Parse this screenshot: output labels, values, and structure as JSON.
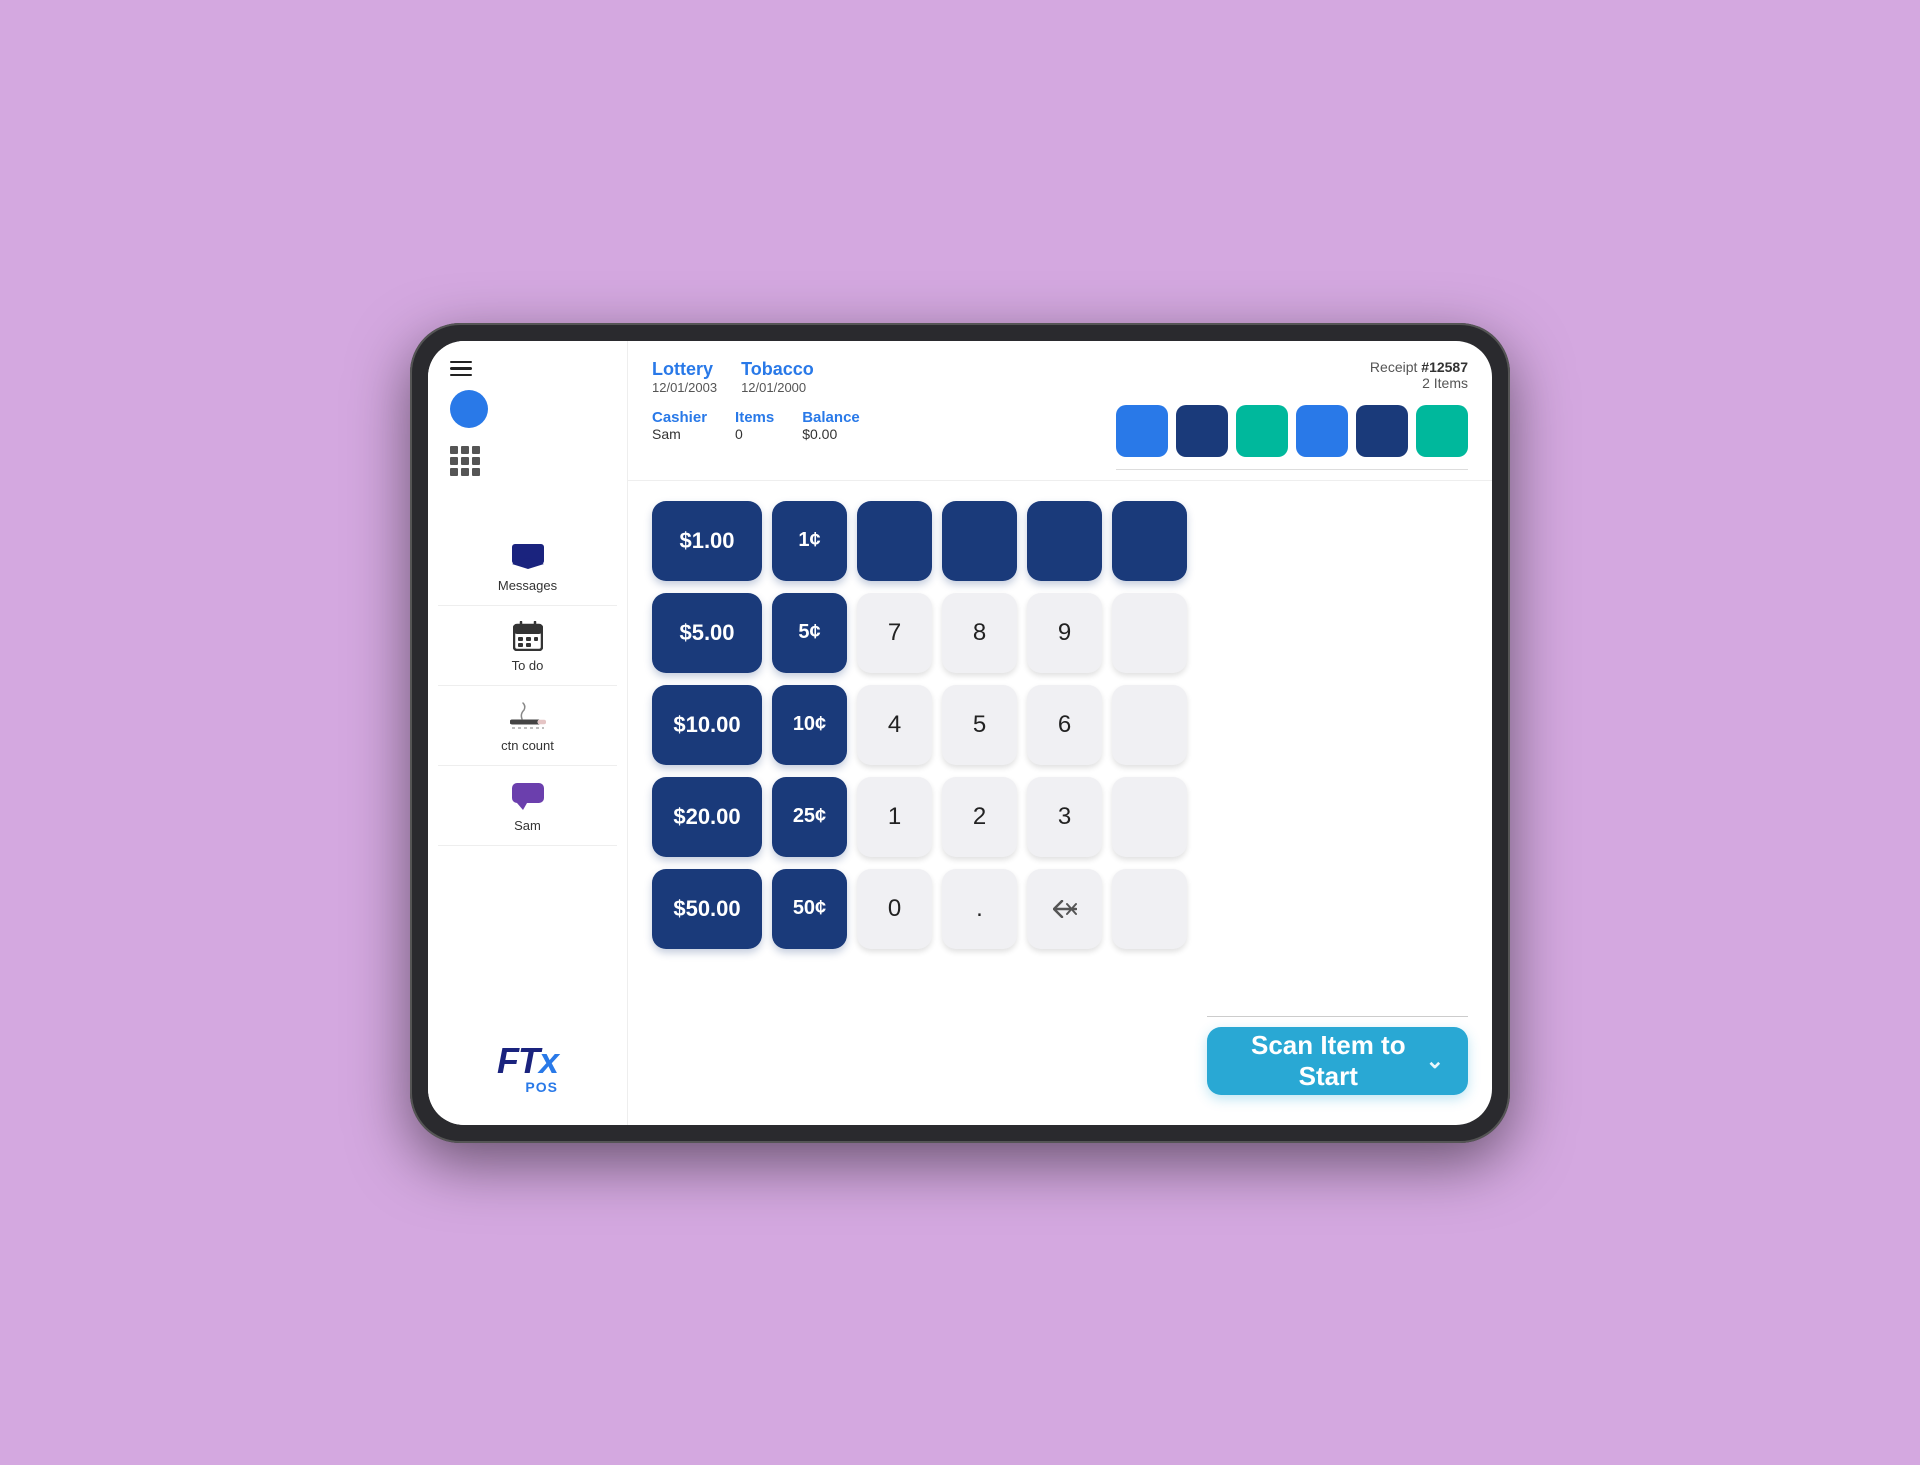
{
  "tablet": {
    "header": {
      "categories": [
        {
          "name": "Lottery",
          "date": "12/01/2003"
        },
        {
          "name": "Tobacco",
          "date": "12/01/2000"
        }
      ],
      "cashier_label": "Cashier",
      "cashier_value": "Sam",
      "items_label": "Items",
      "items_value": "0",
      "balance_label": "Balance",
      "balance_value": "$0.00",
      "receipt_label": "Receipt #",
      "receipt_number": "12587",
      "items_count_label": "2 Items"
    },
    "swatches": [
      {
        "color": "#2979E8",
        "id": "swatch-blue"
      },
      {
        "color": "#1a3a7a",
        "id": "swatch-darkblue"
      },
      {
        "color": "#00b89c",
        "id": "swatch-teal"
      },
      {
        "color": "#2979E8",
        "id": "swatch-blue2"
      },
      {
        "color": "#1a3a7a",
        "id": "swatch-darkblue2"
      },
      {
        "color": "#00b89c",
        "id": "swatch-teal2"
      }
    ],
    "sidebar": {
      "nav_items": [
        {
          "label": "Messages",
          "icon": "message-icon"
        },
        {
          "label": "To do",
          "icon": "calendar-icon"
        },
        {
          "label": "ctn count",
          "icon": "cigarette-icon"
        },
        {
          "label": "Sam",
          "icon": "chat-icon"
        }
      ],
      "logo_main": "FTx",
      "logo_sub": "POS"
    },
    "numpad": {
      "rows": [
        {
          "dollar_label": "$1.00",
          "cent_label": "1¢",
          "keys": [
            "",
            "",
            "",
            ""
          ]
        },
        {
          "dollar_label": "$5.00",
          "cent_label": "5¢",
          "keys": [
            "7",
            "8",
            "9",
            ""
          ]
        },
        {
          "dollar_label": "$10.00",
          "cent_label": "10¢",
          "keys": [
            "4",
            "5",
            "6",
            ""
          ]
        },
        {
          "dollar_label": "$20.00",
          "cent_label": "25¢",
          "keys": [
            "1",
            "2",
            "3",
            ""
          ]
        },
        {
          "dollar_label": "$50.00",
          "cent_label": "50¢",
          "keys": [
            "0",
            ".",
            "⌫",
            ""
          ]
        }
      ]
    },
    "scan_button": {
      "label": "Scan Item to Start",
      "chevron": "⌄"
    }
  }
}
